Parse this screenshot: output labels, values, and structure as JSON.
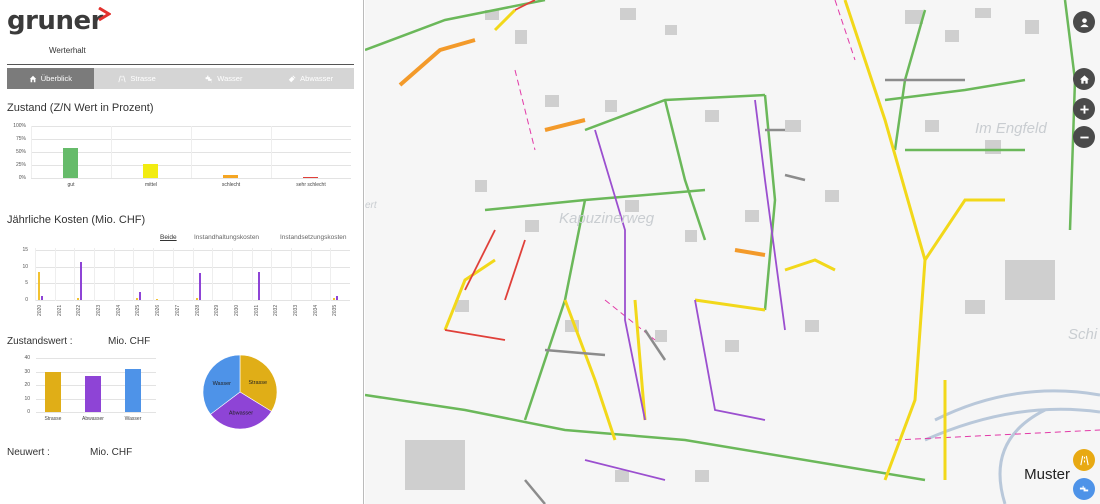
{
  "brand": {
    "name": "gruner",
    "subtitle": "Werterhalt",
    "accent": "#e3312d"
  },
  "tabs": [
    {
      "label": "Überblick",
      "icon": "home-icon",
      "active": true
    },
    {
      "label": "Strasse",
      "icon": "road-icon",
      "active": false
    },
    {
      "label": "Wasser",
      "icon": "water-tap-icon",
      "active": false
    },
    {
      "label": "Abwasser",
      "icon": "pipe-icon",
      "active": false
    }
  ],
  "zustand": {
    "title": "Zustand (Z/N Wert in Prozent)",
    "y_ticks": [
      "100%",
      "75%",
      "50%",
      "25%",
      "0%"
    ],
    "chart_data": {
      "type": "bar",
      "categories": [
        "gut",
        "mittel",
        "schlecht",
        "sehr schlecht"
      ],
      "values": [
        58,
        26,
        5,
        1
      ],
      "colors": [
        "#66bb6a",
        "#f2ec11",
        "#f5a623",
        "#e0403a"
      ],
      "ylim": [
        0,
        100
      ]
    }
  },
  "kosten": {
    "title": "Jährliche Kosten (Mio. CHF)",
    "filters": [
      "Beide",
      "Instandhaltungskosten",
      "Instandsetzungskosten"
    ],
    "y_ticks": [
      "15",
      "10",
      "5",
      "0"
    ],
    "chart_data": {
      "type": "bar",
      "categories": [
        "2020",
        "2021",
        "2022",
        "2023",
        "2024",
        "2025",
        "2026",
        "2027",
        "2028",
        "2029",
        "2030",
        "2031",
        "2032",
        "2033",
        "2034",
        "2035"
      ],
      "series": [
        {
          "name": "Instandhaltungskosten",
          "color": "#f2c230",
          "values": [
            8.5,
            0,
            0.6,
            0,
            0,
            0.6,
            0.2,
            0,
            0.6,
            0,
            0,
            0,
            0,
            0,
            0,
            0.6
          ]
        },
        {
          "name": "Instandsetzungskosten",
          "color": "#8e44d6",
          "values": [
            1.2,
            0,
            11.5,
            0,
            0,
            2.5,
            0,
            0,
            8,
            0,
            0,
            8.5,
            0,
            0,
            0,
            1.2
          ]
        }
      ],
      "ylim": [
        0,
        15
      ]
    }
  },
  "zustandswert": {
    "title": "Zustandswert :",
    "unit": "Mio. CHF",
    "y_ticks": [
      "40",
      "30",
      "20",
      "10",
      "0"
    ],
    "chart_data": {
      "type": "bar",
      "categories": [
        "Strasse",
        "Abwasser",
        "Wasser"
      ],
      "values": [
        29.5,
        27,
        32
      ],
      "colors": [
        "#e0ae17",
        "#8e44d6",
        "#4e93e8"
      ],
      "ylim": [
        0,
        40
      ]
    },
    "pie": {
      "type": "pie",
      "labels": [
        "Strasse",
        "Abwasser",
        "Wasser"
      ],
      "values": [
        33.8,
        30.9,
        35.3
      ],
      "colors": [
        "#e0ae17",
        "#8e44d6",
        "#4e93e8"
      ]
    }
  },
  "neuwert": {
    "title": "Neuwert :",
    "unit": "Mio. CHF"
  },
  "map": {
    "place_labels": [
      "Kapuzinerweg",
      "Im Engfeld",
      "Schi",
      "ert"
    ],
    "watermark": "Muster",
    "controls": [
      {
        "name": "user-button",
        "icon": "user-icon"
      },
      {
        "name": "home-button",
        "icon": "home-icon"
      },
      {
        "name": "zoom-in-button",
        "icon": "plus-icon"
      },
      {
        "name": "zoom-out-button",
        "icon": "minus-icon"
      },
      {
        "name": "layer-road-button",
        "icon": "road-icon"
      },
      {
        "name": "layer-water-button",
        "icon": "water-tap-icon"
      }
    ]
  }
}
